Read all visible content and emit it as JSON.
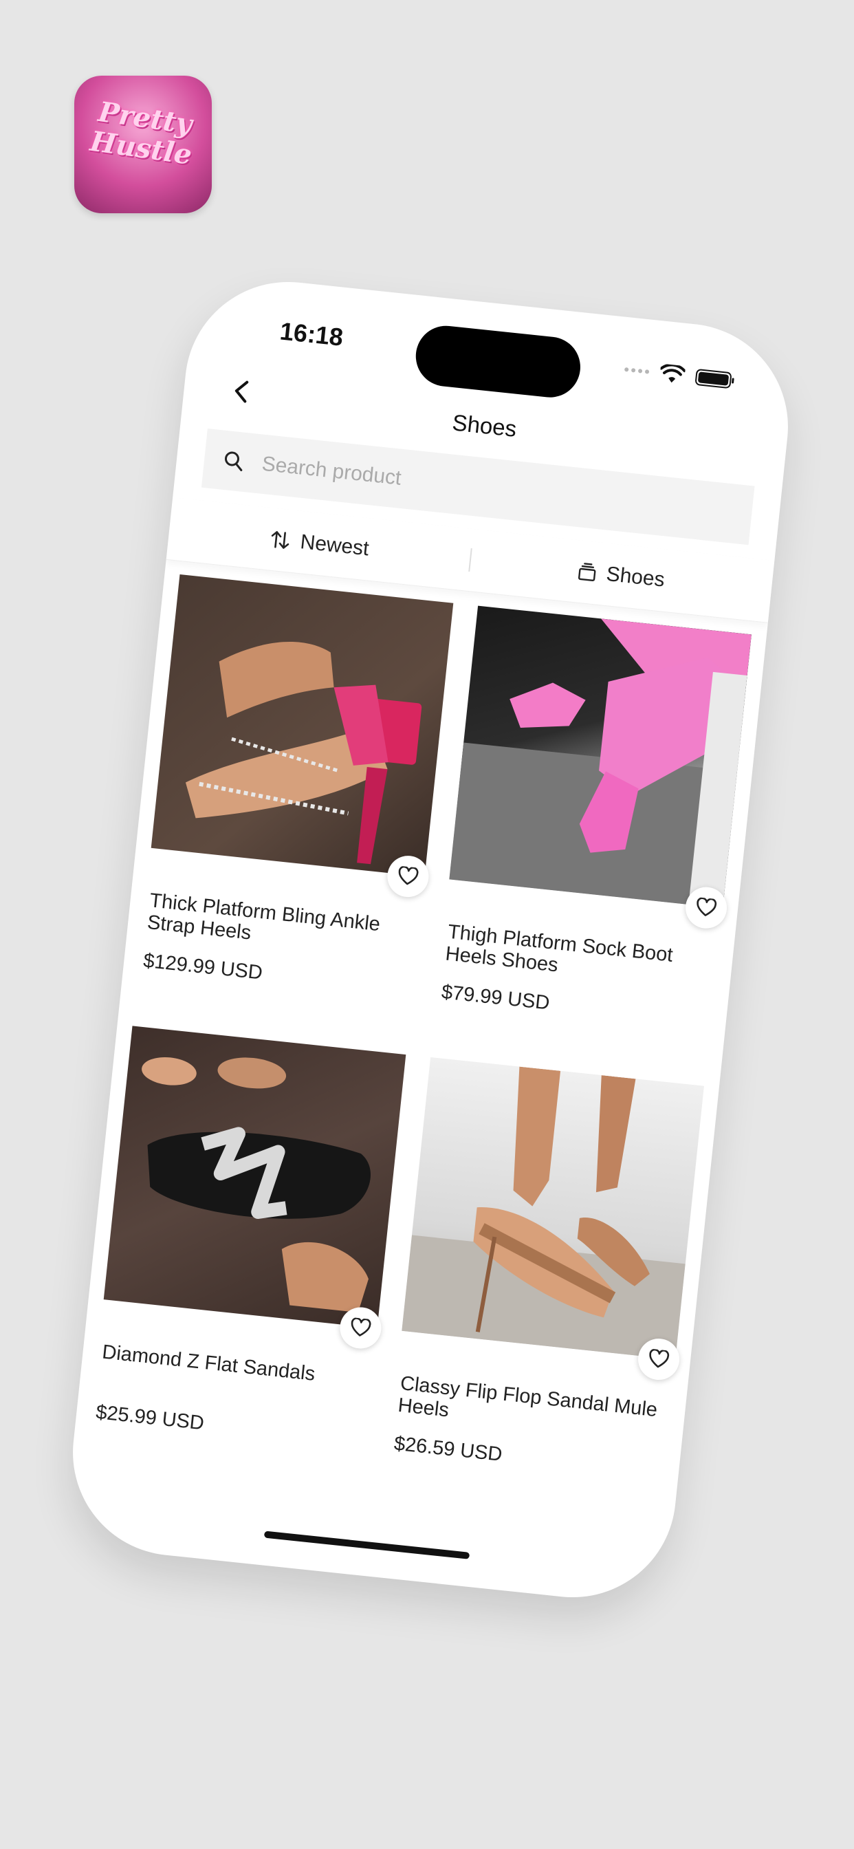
{
  "app": {
    "icon_text": "Pretty Hustle"
  },
  "status_bar": {
    "time": "16:18"
  },
  "header": {
    "title": "Shoes"
  },
  "search": {
    "placeholder": "Search product"
  },
  "filters": {
    "sort_label": "Newest",
    "category_label": "Shoes"
  },
  "products": [
    {
      "name": "Thick Platform Bling Ankle Strap Heels",
      "price": "$129.99 USD",
      "favorited": false
    },
    {
      "name": "Thigh Platform Sock Boot Heels Shoes",
      "price": "$79.99 USD",
      "favorited": false
    },
    {
      "name": "Diamond Z Flat Sandals",
      "price": "$25.99 USD",
      "favorited": false
    },
    {
      "name": "Classy Flip Flop Sandal Mule Heels",
      "price": "$26.59 USD",
      "favorited": false
    }
  ],
  "colors": {
    "accent_pink": "#e23d7a",
    "background": "#e6e6e6"
  }
}
